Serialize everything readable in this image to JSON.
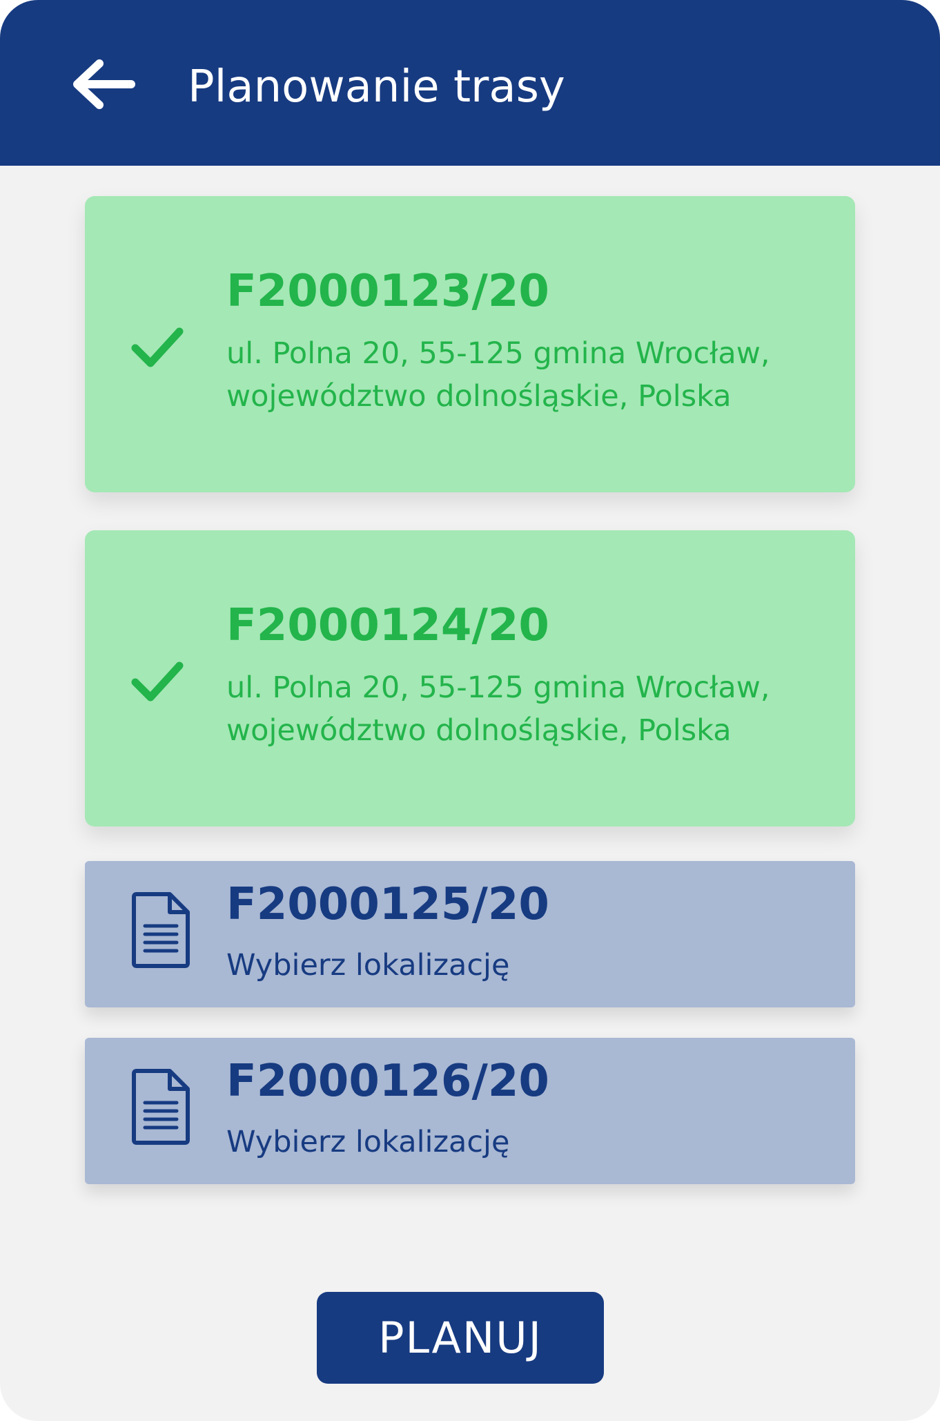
{
  "colors": {
    "primary": "#173b81",
    "success_bg": "#a4e8b5",
    "success_text": "#23b44b",
    "pending_bg": "#a9b8d3",
    "background": "#f2f2f2"
  },
  "header": {
    "back_icon": "arrow-left-icon",
    "title": "Planowanie trasy"
  },
  "invoices": [
    {
      "code": "F2000123/20",
      "status": "located",
      "status_icon": "check-icon",
      "address_line1": "ul. Polna 20, 55-125 gmina Wrocław,",
      "address_line2": "województwo dolnośląskie, Polska"
    },
    {
      "code": "F2000124/20",
      "status": "located",
      "status_icon": "check-icon",
      "address_line1": "ul. Polna 20, 55-125 gmina Wrocław,",
      "address_line2": "województwo dolnośląskie, Polska"
    },
    {
      "code": "F2000125/20",
      "status": "pending",
      "status_icon": "document-icon",
      "hint": "Wybierz lokalizację"
    },
    {
      "code": "F2000126/20",
      "status": "pending",
      "status_icon": "document-icon",
      "hint": "Wybierz lokalizację"
    }
  ],
  "footer": {
    "plan_button_label": "PLANUJ"
  }
}
